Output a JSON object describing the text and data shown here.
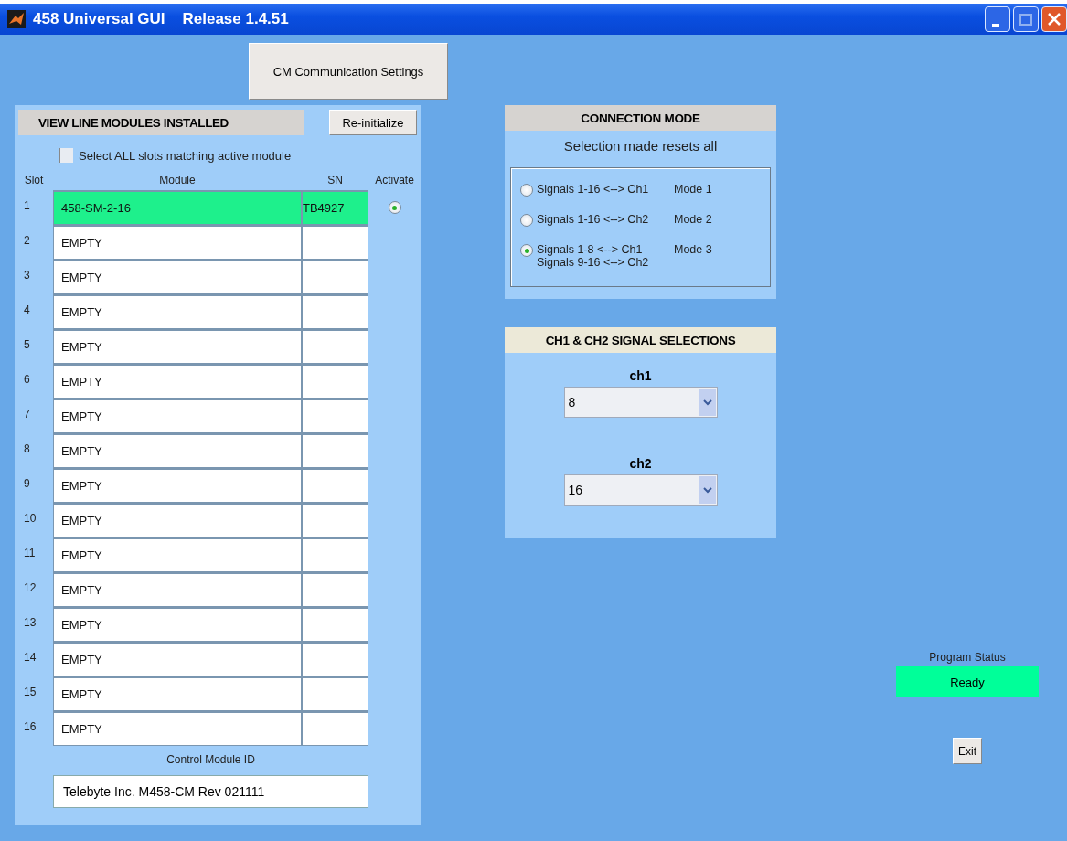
{
  "window": {
    "title": "458 Universal GUI    Release 1.4.51"
  },
  "cm_button": "CM Communication Settings",
  "modules_panel": {
    "title": "VIEW LINE MODULES INSTALLED",
    "reinit_button": "Re-initialize",
    "select_all": {
      "label": "Select ALL slots matching active module",
      "checked": false
    },
    "columns": [
      "Slot",
      "Module",
      "SN",
      "Activate"
    ],
    "rows": [
      {
        "slot": "1",
        "module": "458-SM-2-16",
        "sn": "TB4927",
        "active": true
      },
      {
        "slot": "2",
        "module": "EMPTY",
        "active": false
      },
      {
        "slot": "3",
        "module": "EMPTY",
        "active": false
      },
      {
        "slot": "4",
        "module": "EMPTY",
        "active": false
      },
      {
        "slot": "5",
        "module": "EMPTY",
        "active": false
      },
      {
        "slot": "6",
        "module": "EMPTY",
        "active": false
      },
      {
        "slot": "7",
        "module": "EMPTY",
        "active": false
      },
      {
        "slot": "8",
        "module": "EMPTY",
        "active": false
      },
      {
        "slot": "9",
        "module": "EMPTY",
        "active": false
      },
      {
        "slot": "10",
        "module": "EMPTY",
        "active": false
      },
      {
        "slot": "11",
        "module": "EMPTY",
        "active": false
      },
      {
        "slot": "12",
        "module": "EMPTY",
        "active": false
      },
      {
        "slot": "13",
        "module": "EMPTY",
        "active": false
      },
      {
        "slot": "14",
        "module": "EMPTY",
        "active": false
      },
      {
        "slot": "15",
        "module": "EMPTY",
        "active": false
      },
      {
        "slot": "16",
        "module": "EMPTY",
        "active": false
      }
    ],
    "control_module_label": "Control Module ID",
    "control_module_id": "Telebyte Inc. M458-CM Rev 021111"
  },
  "connection_mode": {
    "title": "CONNECTION MODE",
    "note": "Selection made resets all",
    "options": [
      {
        "lines": [
          "Signals 1-16 <--> Ch1"
        ],
        "mode": "Mode 1",
        "selected": false
      },
      {
        "lines": [
          "Signals 1-16 <--> Ch2"
        ],
        "mode": "Mode 2",
        "selected": false
      },
      {
        "lines": [
          "Signals 1-8 <--> Ch1",
          "Signals 9-16 <--> Ch2"
        ],
        "mode": "Mode 3",
        "selected": true
      }
    ]
  },
  "signal_selections": {
    "title": "CH1 & CH2 SIGNAL SELECTIONS",
    "channels": [
      {
        "label": "ch1",
        "value": "8"
      },
      {
        "label": "ch2",
        "value": "16"
      }
    ]
  },
  "program_status": {
    "label": "Program Status",
    "value": "Ready"
  },
  "exit_button": "Exit"
}
